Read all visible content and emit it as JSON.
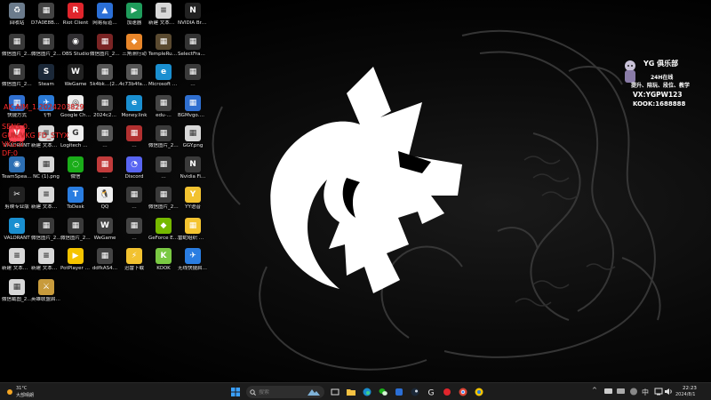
{
  "desktop_icons": [
    {
      "label": "回收站",
      "color": "#6b7b8c",
      "glyph": "♻",
      "icon": "recycle-bin-icon"
    },
    {
      "label": "D7A0E8BA4…",
      "color": "#444",
      "glyph": "▦",
      "icon": "file-icon"
    },
    {
      "label": "Riot Client",
      "color": "#e0252c",
      "glyph": "R",
      "icon": "riot-client-icon"
    },
    {
      "label": "网易有道…",
      "color": "#2b6fd6",
      "glyph": "▲",
      "icon": "app-icon"
    },
    {
      "label": "加速器",
      "color": "#1f9c5b",
      "glyph": "▶",
      "icon": "accelerator-icon"
    },
    {
      "label": "新建 文本文档.txt",
      "color": "#d8d8d8",
      "glyph": "≡",
      "icon": "text-file-icon"
    },
    {
      "label": "NVIDIA Broadcast",
      "color": "#222",
      "glyph": "N",
      "icon": "nvidia-broadcast-icon"
    },
    {
      "label": "微信图片_20240807…",
      "color": "#3a3a3a",
      "glyph": "▦",
      "icon": "image-file-icon"
    },
    {
      "label": "微信图片_20240807…",
      "color": "#3a3a3a",
      "glyph": "▦",
      "icon": "image-file-icon"
    },
    {
      "label": "OBS Studio",
      "color": "#302e31",
      "glyph": "◉",
      "icon": "obs-studio-icon"
    },
    {
      "label": "微信图片_20240807…",
      "color": "#7a2424",
      "glyph": "▦",
      "icon": "image-file-icon"
    },
    {
      "label": "三角洲行动",
      "color": "#e8862a",
      "glyph": "◆",
      "icon": "game-icon"
    },
    {
      "label": "TempleRun…",
      "color": "#5a4a30",
      "glyph": "▦",
      "icon": "game-icon"
    },
    {
      "label": "SelectFrame…",
      "color": "#333",
      "glyph": "▦",
      "icon": "file-icon"
    },
    {
      "label": "微信图片_20240807…",
      "color": "#3a3a3a",
      "glyph": "▦",
      "icon": "image-file-icon"
    },
    {
      "label": "Steam",
      "color": "#1b2838",
      "glyph": "S",
      "icon": "steam-icon"
    },
    {
      "label": "WeGame",
      "color": "#222",
      "glyph": "W",
      "icon": "wegame-icon"
    },
    {
      "label": "5k4bk…(2).png",
      "color": "#555",
      "glyph": "▦",
      "icon": "image-file-icon"
    },
    {
      "label": "4c73b4fac…(2).png",
      "color": "#555",
      "glyph": "▦",
      "icon": "image-file-icon"
    },
    {
      "label": "Microsoft Edge",
      "color": "#1a8fd0",
      "glyph": "e",
      "icon": "edge-icon"
    },
    {
      "label": "…",
      "color": "#3a3a3a",
      "glyph": "▦",
      "icon": "file-icon"
    },
    {
      "label": "快捷方式",
      "color": "#2f6fd0",
      "glyph": "▦",
      "icon": "shortcut-icon"
    },
    {
      "label": "飞书",
      "color": "#2b7bd8",
      "glyph": "✈",
      "icon": "feishu-icon"
    },
    {
      "label": "Google Chrome",
      "color": "#eee",
      "glyph": "◎",
      "icon": "chrome-icon"
    },
    {
      "label": "2024c2…",
      "color": "#444",
      "glyph": "▦",
      "icon": "file-icon"
    },
    {
      "label": "Money.link",
      "color": "#1a8fd0",
      "glyph": "e",
      "icon": "edge-icon"
    },
    {
      "label": "edu-…",
      "color": "#444",
      "glyph": "▦",
      "icon": "file-icon"
    },
    {
      "label": "BGMvgo.HF…",
      "color": "#2f6fd0",
      "glyph": "▦",
      "icon": "shortcut-icon"
    },
    {
      "label": "VALORANT",
      "color": "#ff4655",
      "glyph": "V",
      "icon": "valorant-icon"
    },
    {
      "label": "新建 文本文档.txt",
      "color": "#d8d8d8",
      "glyph": "≡",
      "icon": "text-file-icon"
    },
    {
      "label": "Logitech G HUB",
      "color": "#eee",
      "glyph": "G",
      "icon": "logitech-ghub-icon"
    },
    {
      "label": "…",
      "color": "#555",
      "glyph": "▦",
      "icon": "file-icon"
    },
    {
      "label": "…",
      "color": "#b23030",
      "glyph": "▦",
      "icon": "file-icon"
    },
    {
      "label": "微信图片_20240807…",
      "color": "#3a3a3a",
      "glyph": "▦",
      "icon": "image-file-icon"
    },
    {
      "label": "GGY.png",
      "color": "#d8d8d8",
      "glyph": "▦",
      "icon": "image-file-icon"
    },
    {
      "label": "TeamSpeak 3 Client",
      "color": "#2d6fb3",
      "glyph": "◉",
      "icon": "teamspeak-icon"
    },
    {
      "label": "NC (1).png",
      "color": "#d8d8d8",
      "glyph": "▦",
      "icon": "image-file-icon"
    },
    {
      "label": "微信",
      "color": "#1aad19",
      "glyph": "◌",
      "icon": "wechat-icon"
    },
    {
      "label": "…",
      "color": "#c13b3b",
      "glyph": "▦",
      "icon": "app-icon"
    },
    {
      "label": "Discord",
      "color": "#5865f2",
      "glyph": "◔",
      "icon": "discord-icon"
    },
    {
      "label": "…",
      "color": "#3a3a3a",
      "glyph": "▦",
      "icon": "image-file-icon"
    },
    {
      "label": "Nvidia Fi…",
      "color": "#3a3a3a",
      "glyph": "N",
      "icon": "app-icon"
    },
    {
      "label": "剪映专业版",
      "color": "#222",
      "glyph": "✂",
      "icon": "capcut-icon"
    },
    {
      "label": "新建 文本文档 (4).txt",
      "color": "#d8d8d8",
      "glyph": "≡",
      "icon": "text-file-icon"
    },
    {
      "label": "ToDesk",
      "color": "#2a7de1",
      "glyph": "T",
      "icon": "todesk-icon"
    },
    {
      "label": "QQ",
      "color": "#eee",
      "glyph": "🐧",
      "icon": "qq-icon"
    },
    {
      "label": "…",
      "color": "#3a3a3a",
      "glyph": "▦",
      "icon": "image-file-icon"
    },
    {
      "label": "微信图片_20240807…",
      "color": "#3a3a3a",
      "glyph": "▦",
      "icon": "image-file-icon"
    },
    {
      "label": "YY语音",
      "color": "#f2c230",
      "glyph": "Y",
      "icon": "yy-icon"
    },
    {
      "label": "VALORANT",
      "color": "#1a8fd0",
      "glyph": "e",
      "icon": "edge-icon"
    },
    {
      "label": "微信图片_20240807…",
      "color": "#3a3a3a",
      "glyph": "▦",
      "icon": "image-file-icon"
    },
    {
      "label": "微信图片_20240807…",
      "color": "#3a3a3a",
      "glyph": "▦",
      "icon": "image-file-icon"
    },
    {
      "label": "WeGame",
      "color": "#444",
      "glyph": "W",
      "icon": "wegame-icon"
    },
    {
      "label": "…",
      "color": "#444",
      "glyph": "▦",
      "icon": "file-icon"
    },
    {
      "label": "GeForce Experience",
      "color": "#76b900",
      "glyph": "◆",
      "icon": "geforce-icon"
    },
    {
      "label": "雷蛇组织 WeGame版",
      "color": "#f4c430",
      "glyph": "▦",
      "icon": "app-icon"
    },
    {
      "label": "新建 文本文档 (2).txt",
      "color": "#d8d8d8",
      "glyph": "≡",
      "icon": "text-file-icon"
    },
    {
      "label": "新建 文本文档 (3).txt",
      "color": "#d8d8d8",
      "glyph": "≡",
      "icon": "text-file-icon"
    },
    {
      "label": "PotPlayer 64 bit",
      "color": "#f5c400",
      "glyph": "▶",
      "icon": "potplayer-icon"
    },
    {
      "label": "ddfkAS4…",
      "color": "#444",
      "glyph": "▦",
      "icon": "file-icon"
    },
    {
      "label": "迅雷下载",
      "color": "#f2c230",
      "glyph": "⚡",
      "icon": "download-icon"
    },
    {
      "label": "KOOK",
      "color": "#7ac943",
      "glyph": "K",
      "icon": "kook-icon"
    },
    {
      "label": "无线快捷启动器",
      "color": "#2a7de1",
      "glyph": "✈",
      "icon": "app-icon"
    },
    {
      "label": "微信截图_20240…",
      "color": "#d8d8d8",
      "glyph": "▦",
      "icon": "image-file-icon"
    },
    {
      "label": "英雄联盟启动器",
      "color": "#c89b3c",
      "glyph": "⚔",
      "icon": "lol-icon"
    }
  ],
  "overlay_text": {
    "line1": "AK AIM_1.2024203829",
    "line2": "SENS:0.",
    "line3": "GUN:VKG FD_STYX",
    "line4": "VKG:0",
    "line5": "DF:0"
  },
  "club": {
    "name": "YG 俱乐部",
    "hours": "24H在线",
    "services": "提升、陪玩、段位、教学",
    "wechat": "VX:YGPW123",
    "kook": "KOOK:1688888"
  },
  "taskbar": {
    "weather_temp": "31°C",
    "weather_cond": "大部晴朗",
    "search_placeholder": "搜索",
    "time": "22:23",
    "date": "2024/8/1"
  }
}
